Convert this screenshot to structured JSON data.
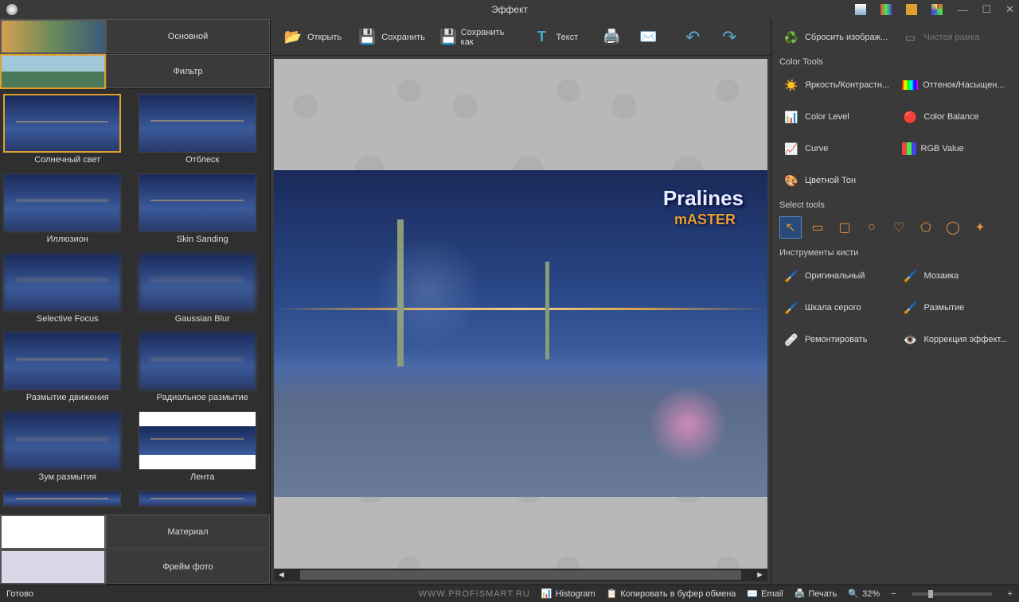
{
  "title": "Эффект",
  "toolbar": {
    "open": "Открыть",
    "save": "Сохранить",
    "saveas": "Сохранить как",
    "text": "Текст"
  },
  "categories": {
    "main": "Основной",
    "filter": "Фильтр",
    "material": "Материал",
    "frame": "Фрейм фото"
  },
  "filters": [
    "Солнечный свет",
    "Отблеск",
    "Иллюзион",
    "Skin Sanding",
    "Selective Focus",
    "Gaussian Blur",
    "Размытие движения",
    "Радиальное размытие",
    "Зум размытия",
    "Лента"
  ],
  "watermark": {
    "line1": "Pralines",
    "line2": "mASTER"
  },
  "right": {
    "reset": "Сбросить изображ...",
    "clearframe": "Чистая рамка",
    "colortools_h": "Color Tools",
    "brightness": "Яркость/Контрастн...",
    "hue": "Оттенок/Насыщен...",
    "colorlevel": "Color Level",
    "colorbalance": "Color Balance",
    "curve": "Curve",
    "rgb": "RGB Value",
    "colortone": "Цветной Тон",
    "selecttools_h": "Select tools",
    "brushtools_h": "Инструменты кисти",
    "original": "Оригинальный",
    "mosaic": "Мозаика",
    "grayscale": "Шкала серого",
    "blur": "Размытие",
    "repair": "Ремонтировать",
    "effectcorr": "Коррекция эффект..."
  },
  "status": {
    "ready": "Готово",
    "site": "WWW.PROFISMART.RU",
    "histogram": "Histogram",
    "copy": "Копировать в буфер обмена",
    "email": "Email",
    "print": "Печать",
    "zoom": "32%"
  }
}
